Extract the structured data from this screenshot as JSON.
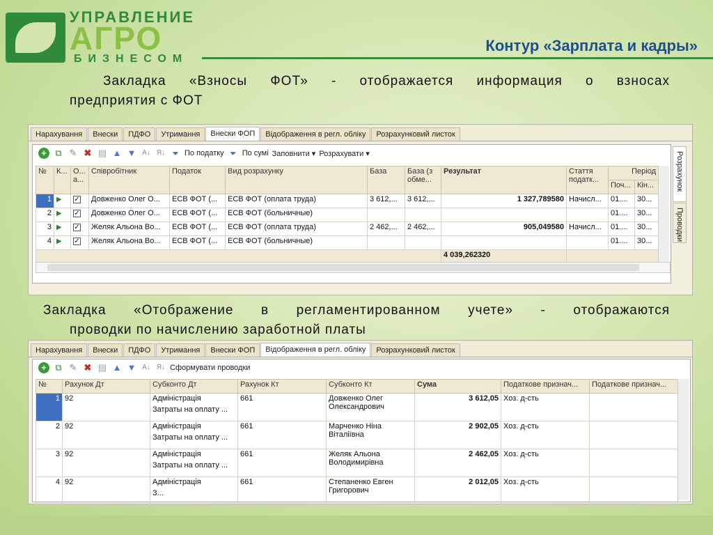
{
  "logo": {
    "line1": "УПРАВЛЕНИЕ",
    "line2": "АГРО",
    "line3": "БИЗНЕСОМ"
  },
  "slide_title": "Контур «Зарплата и кадры»",
  "para1": {
    "line1": "Закладка «Взносы ФОТ» - отображается информация о взносах",
    "line2": "предприятия с ФОТ"
  },
  "para2": {
    "line1": "Закладка «Отображение в регламентированном учете» - отображаются",
    "line2": "проводки по начислению заработной платы"
  },
  "win1": {
    "tabs": [
      "Нарахування",
      "Внески",
      "ПДФО",
      "Утримання",
      "Внески ФОП",
      "Відображення в регл. обліку",
      "Розрахунковий листок"
    ],
    "active_tab": "Внески ФОП",
    "toolbar": {
      "by_tax": "По податку",
      "by_sum": "По сумі",
      "fill": "Заповнити ▾",
      "calc": "Розрахувати ▾"
    },
    "headers": {
      "n": "№",
      "k": "К...",
      "o": "О... а...",
      "employee": "Співробітник",
      "tax": "Податок",
      "calc_type": "Вид розрахунку",
      "base": "База",
      "base_lim": "База (з обме...",
      "result": "Результат",
      "article": "Стаття податк...",
      "period": "Період",
      "start": "Поч...",
      "end": "Кін..."
    },
    "rows": [
      {
        "n": "1",
        "employee": "Довженко Олег О...",
        "tax": "ЕСВ ФОТ (...",
        "calc_type": "ЕСВ ФОТ (оплата труда)",
        "base": "3 612,...",
        "base_lim": "3 612,...",
        "result": "1 327,789580",
        "article": "Начисл...",
        "start": "01....",
        "end": "30..."
      },
      {
        "n": "2",
        "employee": "Довженко Олег О...",
        "tax": "ЕСВ ФОТ (...",
        "calc_type": "ЕСВ ФОТ (больничные)",
        "base": "",
        "base_lim": "",
        "result": "",
        "article": "",
        "start": "01....",
        "end": "30..."
      },
      {
        "n": "3",
        "employee": "Желяк Альона Во...",
        "tax": "ЕСВ ФОТ (...",
        "calc_type": "ЕСВ ФОТ (оплата труда)",
        "base": "2 462,...",
        "base_lim": "2 462,...",
        "result": "905,049580",
        "article": "Начисл...",
        "start": "01....",
        "end": "30..."
      },
      {
        "n": "4",
        "employee": "Желяк Альона Во...",
        "tax": "ЕСВ ФОТ (...",
        "calc_type": "ЕСВ ФОТ (больничные)",
        "base": "",
        "base_lim": "",
        "result": "",
        "article": "",
        "start": "01....",
        "end": "30..."
      }
    ],
    "total": "4 039,262320",
    "side_tabs": [
      "Розрахунок",
      "Проводки"
    ]
  },
  "win2": {
    "tabs": [
      "Нарахування",
      "Внески",
      "ПДФО",
      "Утримання",
      "Внески ФОП",
      "Відображення в регл. обліку",
      "Розрахунковий листок"
    ],
    "active_tab": "Відображення в регл. обліку",
    "toolbar": {
      "form": "Сформувати проводки"
    },
    "headers": {
      "n": "№",
      "dt": "Рахунок Дт",
      "sub_dt": "Субконто Дт",
      "kt": "Рахунок Кт",
      "sub_kt": "Субконто Кт",
      "sum": "Сума",
      "tax1": "Податкове признач...",
      "tax2": "Податкове признач..."
    },
    "rows": [
      {
        "n": "1",
        "dt": "92",
        "sub1": "Адміністрація",
        "sub2": "Затраты на оплату ...",
        "kt": "661",
        "kt_sub1": "Довженко Олег",
        "kt_sub2": "Олександрович",
        "sum": "3 612,05",
        "tax1": "Хоз. д-сть"
      },
      {
        "n": "2",
        "dt": "92",
        "sub1": "Адміністрація",
        "sub2": "Затраты на оплату ...",
        "kt": "661",
        "kt_sub1": "Марченко Ніна",
        "kt_sub2": "Віталіївна",
        "sum": "2 902,05",
        "tax1": "Хоз. д-сть"
      },
      {
        "n": "3",
        "dt": "92",
        "sub1": "Адміністрація",
        "sub2": "Затраты на оплату ...",
        "kt": "661",
        "kt_sub1": "Желяк Альона",
        "kt_sub2": "Володимирівна",
        "sum": "2 462,05",
        "tax1": "Хоз. д-сть"
      },
      {
        "n": "4",
        "dt": "92",
        "sub1": "Адміністрація",
        "sub2": "З...",
        "kt": "661",
        "kt_sub1": "Степаненко Евген",
        "kt_sub2": "Григорович",
        "sum": "2 012,05",
        "tax1": "Хоз. д-сть"
      }
    ]
  }
}
